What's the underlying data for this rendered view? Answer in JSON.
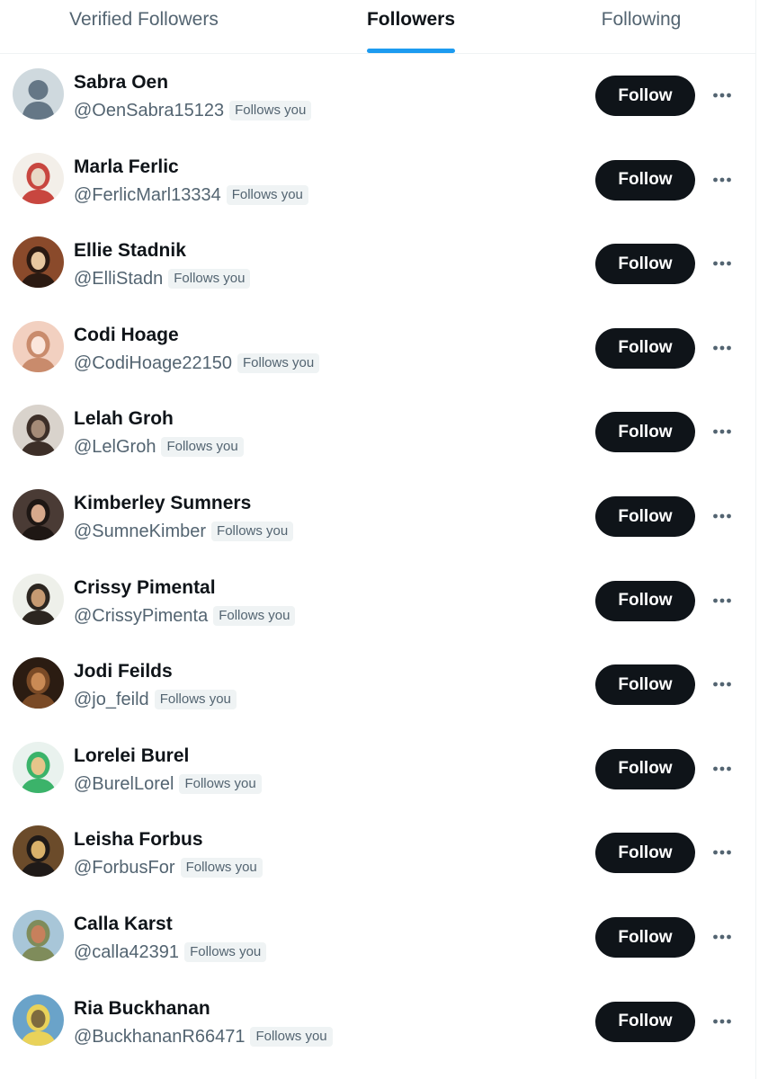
{
  "tabs": [
    {
      "label": "Verified Followers",
      "active": false
    },
    {
      "label": "Followers",
      "active": true
    },
    {
      "label": "Following",
      "active": false
    }
  ],
  "follow_button_label": "Follow",
  "follows_you_label": "Follows you",
  "colors": {
    "accent": "#1d9bf0",
    "button": "#0f1419",
    "secondary_text": "#536471",
    "badge_bg": "#eff3f4"
  },
  "followers": [
    {
      "name": "Sabra Oen",
      "handle": "@OenSabra15123",
      "avatar": "default-avatar"
    },
    {
      "name": "Marla Ferlic",
      "handle": "@FerlicMarl13334",
      "avatar": "photo-avatar"
    },
    {
      "name": "Ellie Stadnik",
      "handle": "@ElliStadn",
      "avatar": "photo-avatar"
    },
    {
      "name": "Codi Hoage",
      "handle": "@CodiHoage22150",
      "avatar": "photo-avatar"
    },
    {
      "name": "Lelah Groh",
      "handle": "@LelGroh",
      "avatar": "photo-avatar"
    },
    {
      "name": "Kimberley Sumners",
      "handle": "@SumneKimber",
      "avatar": "photo-avatar"
    },
    {
      "name": "Crissy Pimental",
      "handle": "@CrissyPimenta",
      "avatar": "photo-avatar"
    },
    {
      "name": "Jodi Feilds",
      "handle": "@jo_feild",
      "avatar": "photo-avatar"
    },
    {
      "name": "Lorelei Burel",
      "handle": "@BurelLorel",
      "avatar": "photo-avatar"
    },
    {
      "name": "Leisha Forbus",
      "handle": "@ForbusFor",
      "avatar": "photo-avatar"
    },
    {
      "name": "Calla Karst",
      "handle": "@calla42391",
      "avatar": "photo-avatar"
    },
    {
      "name": "Ria Buckhanan",
      "handle": "@BuckhananR66471",
      "avatar": "photo-avatar"
    }
  ]
}
